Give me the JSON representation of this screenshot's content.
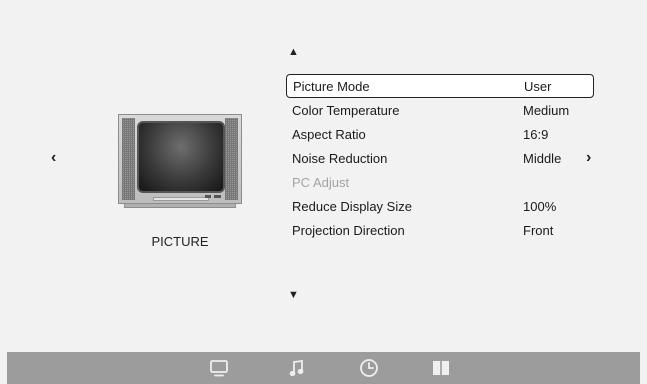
{
  "section": {
    "label": "PICTURE"
  },
  "nav": {
    "prev_glyph": "‹",
    "next_glyph": "›"
  },
  "scroll": {
    "up_glyph": "▲",
    "down_glyph": "▼"
  },
  "menu": {
    "items": [
      {
        "label": "Picture Mode",
        "value": "User",
        "state": "selected"
      },
      {
        "label": "Color Temperature",
        "value": "Medium",
        "state": "normal"
      },
      {
        "label": "Aspect Ratio",
        "value": "16:9",
        "state": "normal"
      },
      {
        "label": "Noise Reduction",
        "value": "Middle",
        "state": "normal"
      },
      {
        "label": "PC Adjust",
        "value": "",
        "state": "disabled"
      },
      {
        "label": "Reduce Display Size",
        "value": "100%",
        "state": "normal"
      },
      {
        "label": "Projection Direction",
        "value": "Front",
        "state": "normal"
      }
    ]
  },
  "bottom_bar": {
    "icons": [
      "monitor-icon",
      "music-note-icon",
      "clock-icon",
      "book-icon"
    ],
    "colors": {
      "bar": "#9c9c9c",
      "icon": "#efefef"
    }
  },
  "colors": {
    "background": "#f2f2f2",
    "text": "#1a1a1a",
    "disabled_text": "#a3a3a3"
  }
}
